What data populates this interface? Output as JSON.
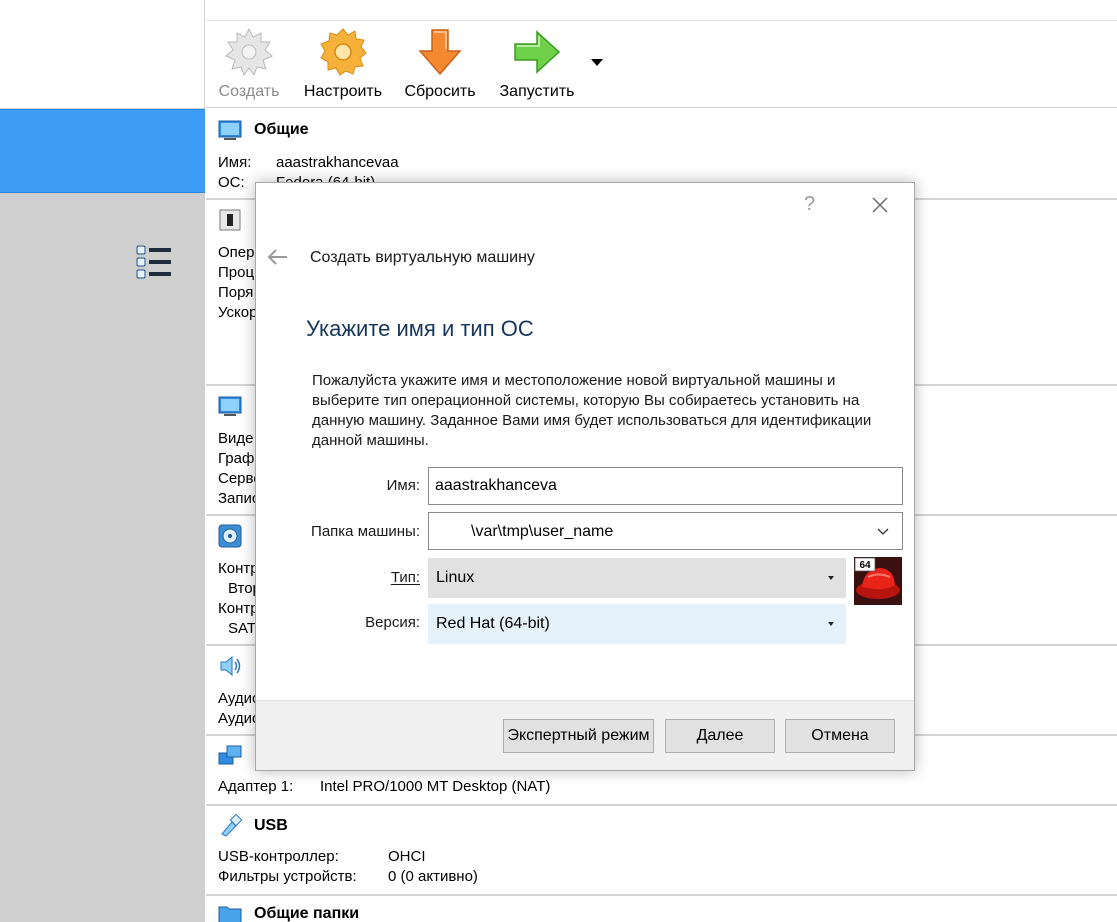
{
  "toolbar": {
    "create_label": "Создать",
    "settings_label": "Настроить",
    "discard_label": "Сбросить",
    "start_label": "Запустить"
  },
  "details": {
    "general": {
      "title": "Общие",
      "name_key": "Имя:",
      "name_value": "aaastrakhancevaa",
      "os_key": "ОС:",
      "os_value": "Fedora (64-bit)"
    },
    "system": {
      "rows": [
        "Опер",
        "Проц",
        "Поря",
        "Ускор"
      ]
    },
    "display": {
      "rows": [
        "Виде",
        "Граф",
        "Серве",
        "Запис"
      ]
    },
    "storage": {
      "rows": [
        "Контр",
        "Втор",
        "Контр",
        "SAT"
      ]
    },
    "audio": {
      "rows": [
        "Аудис",
        "Аудис"
      ]
    },
    "network": {
      "adapter_key": "Адаптер 1:",
      "adapter_value": "Intel PRO/1000 MT Desktop (NAT)"
    },
    "usb": {
      "title": "USB",
      "controller_key": "USB-контроллер:",
      "controller_value": "OHCI",
      "filters_key": "Фильтры устройств:",
      "filters_value": "0 (0 активно)"
    },
    "shared": {
      "title": "Общие папки"
    }
  },
  "dialog": {
    "help": "?",
    "title": "Создать виртуальную машину",
    "heading": "Укажите имя и тип ОС",
    "description": "Пожалуйста укажите имя и местоположение новой виртуальной машины и выберите тип операционной системы, которую Вы собираетесь установить на данную машину. Заданное Вами имя будет использоваться для идентификации данной машины.",
    "name_label": "Имя:",
    "name_value": "aaastrakhanceva",
    "folder_label": "Папка машины:",
    "folder_value": "\\var\\tmp\\user_name",
    "type_label": "Тип:",
    "type_value": "Linux",
    "version_label": "Версия:",
    "version_value": "Red Hat (64-bit)",
    "os_badge": "64",
    "expert_button": "Экспертный режим",
    "next_button": "Далее",
    "cancel_button": "Отмена"
  },
  "colors": {
    "selection": "#3d9cf4",
    "heading": "#17365d",
    "version_combo_bg": "#e5f1fb"
  }
}
